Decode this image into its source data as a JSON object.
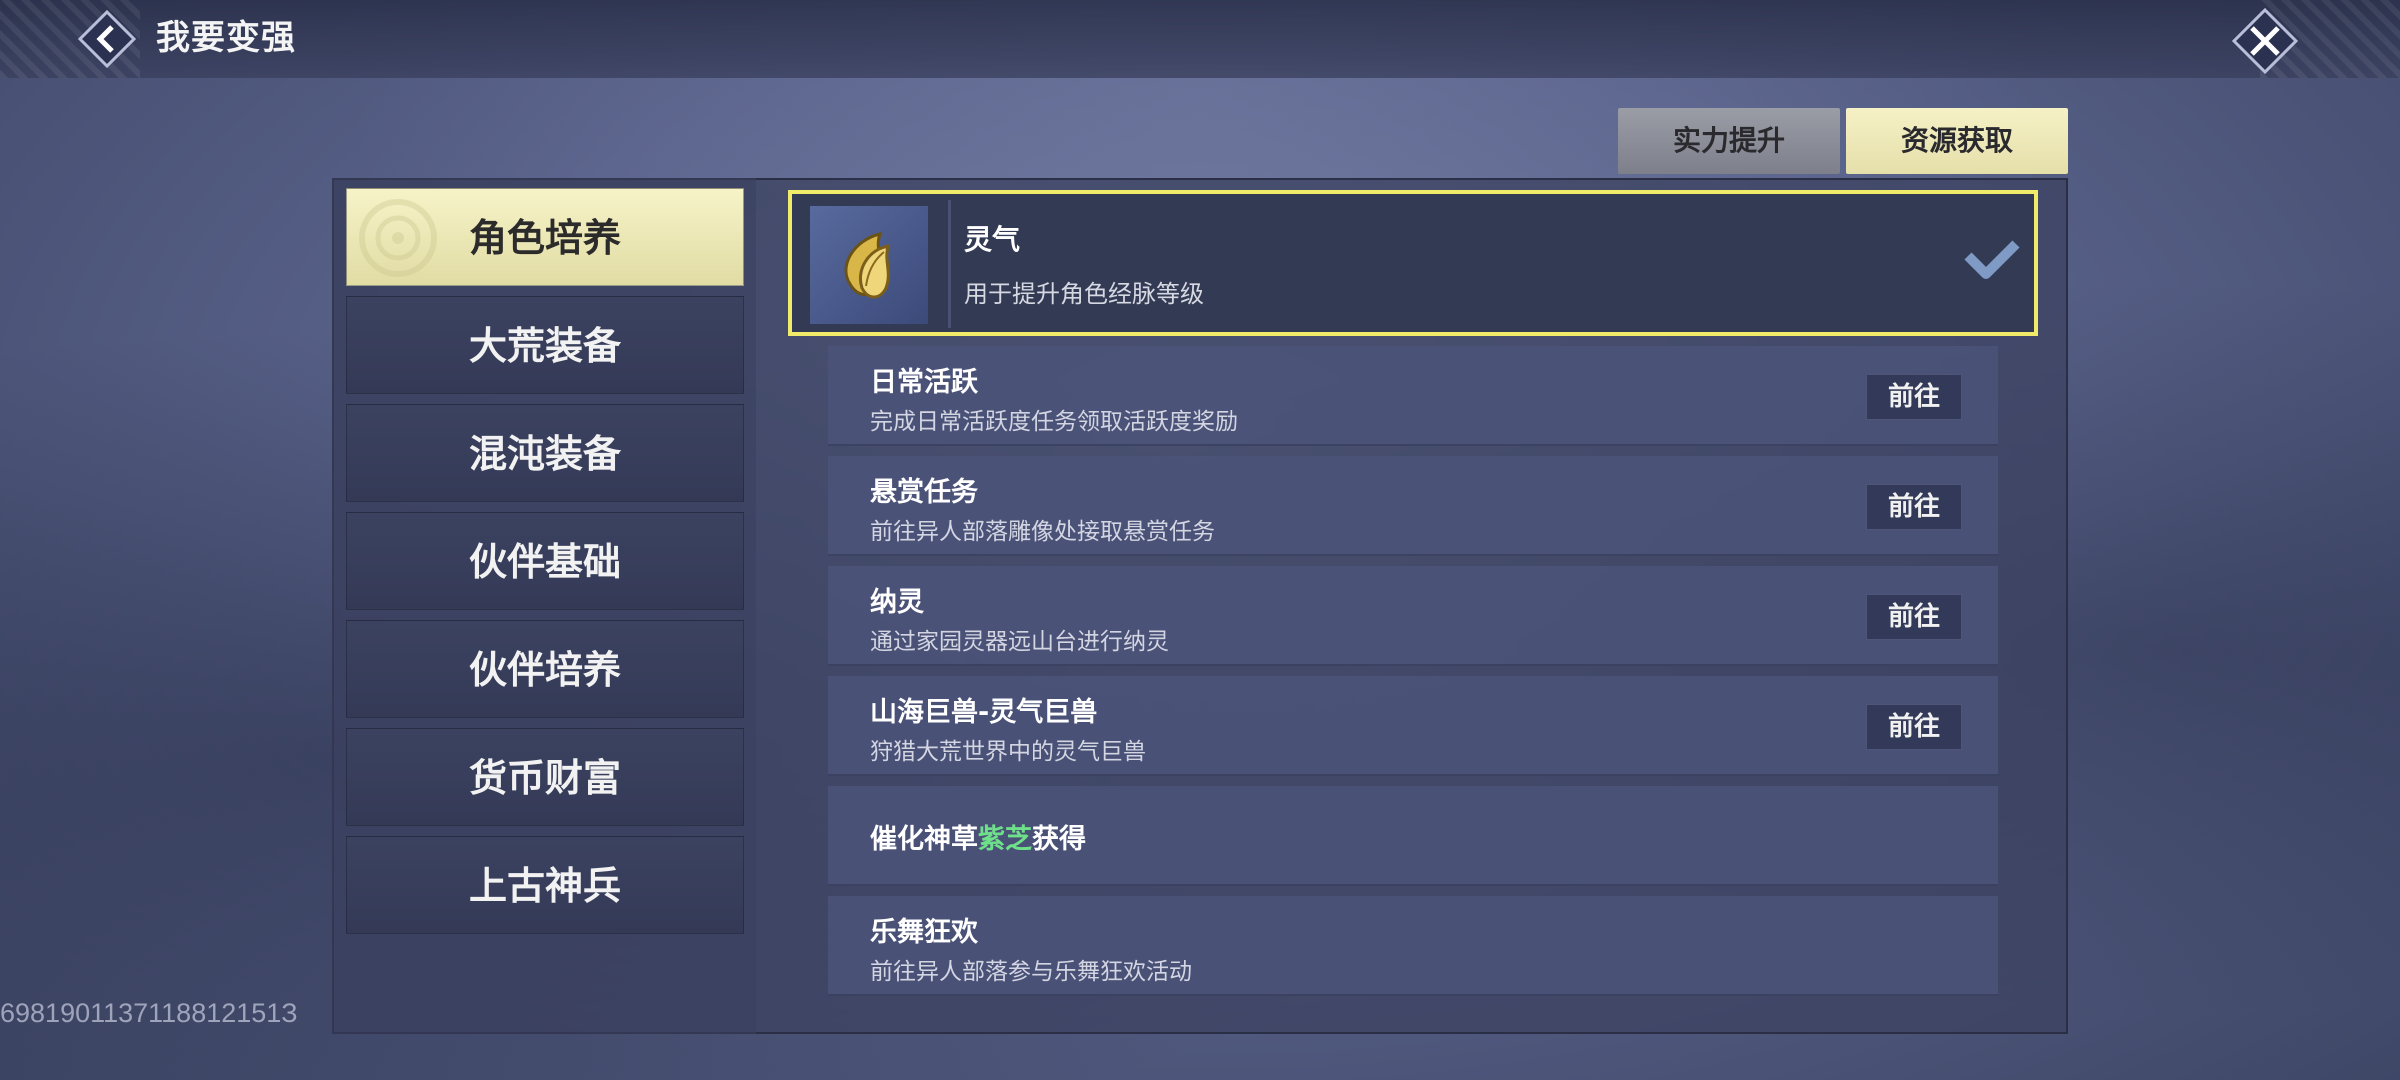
{
  "header": {
    "title": "我要变强"
  },
  "tabs": [
    {
      "label": "实力提升",
      "active": false
    },
    {
      "label": "资源获取",
      "active": true
    }
  ],
  "categories": [
    {
      "label": "角色培养",
      "active": true
    },
    {
      "label": "大荒装备",
      "active": false
    },
    {
      "label": "混沌装备",
      "active": false
    },
    {
      "label": "伙伴基础",
      "active": false
    },
    {
      "label": "伙伴培养",
      "active": false
    },
    {
      "label": "货币财富",
      "active": false
    },
    {
      "label": "上古神兵",
      "active": false
    }
  ],
  "item": {
    "name": "灵气",
    "description": "用于提升角色经脉等级",
    "icon": "gold-feather-icon"
  },
  "sources": [
    {
      "title": "日常活跃",
      "desc": "完成日常活跃度任务领取活跃度奖励",
      "button": "前往"
    },
    {
      "title": "悬赏任务",
      "desc": "前往异人部落雕像处接取悬赏任务",
      "button": "前往"
    },
    {
      "title": "纳灵",
      "desc": "通过家园灵器远山台进行纳灵",
      "button": "前往"
    },
    {
      "title": "山海巨兽-灵气巨兽",
      "desc": "狩猎大荒世界中的灵气巨兽",
      "button": "前往"
    },
    {
      "title_parts": [
        "催化神草",
        "紫芝",
        "获得"
      ]
    },
    {
      "title": "乐舞狂欢",
      "desc": "前往异人部落参与乐舞狂欢活动"
    }
  ],
  "footer": {
    "uid": "6981901137118812151З"
  },
  "colors": {
    "active_tab": "#e5dfaa",
    "highlight_border": "#f0ec6a",
    "green_text": "#6fe08a"
  }
}
